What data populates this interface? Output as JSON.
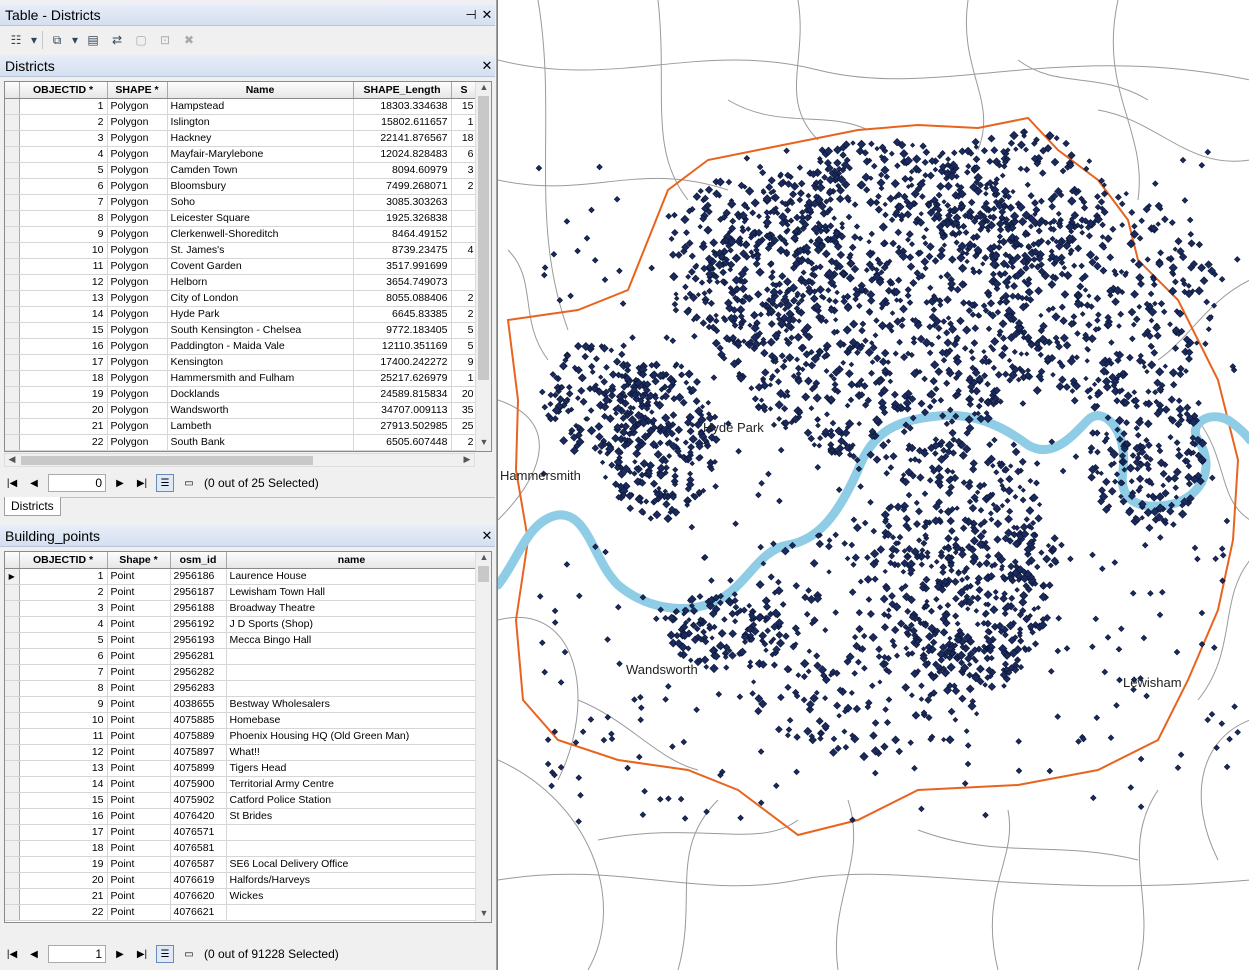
{
  "window": {
    "title": "Table - Districts",
    "pin": "⊣",
    "close": "✕"
  },
  "toolbar": {
    "icons": [
      "table-options-icon",
      "dropdown-icon",
      "related-tables-icon",
      "dropdown-icon",
      "select-by-attributes-icon",
      "switch-selection-icon",
      "clear-selection-icon",
      "zoom-to-selected-icon",
      "delete-selected-icon"
    ]
  },
  "districts": {
    "title": "Districts",
    "close": "✕",
    "columns": [
      "OBJECTID *",
      "SHAPE *",
      "Name",
      "SHAPE_Length",
      "S"
    ],
    "rows": [
      [
        "1",
        "Polygon",
        "Hampstead",
        "18303.334638",
        "15"
      ],
      [
        "2",
        "Polygon",
        "Islington",
        "15802.611657",
        "1"
      ],
      [
        "3",
        "Polygon",
        "Hackney",
        "22141.876567",
        "18"
      ],
      [
        "4",
        "Polygon",
        "Mayfair-Marylebone",
        "12024.828483",
        "6"
      ],
      [
        "5",
        "Polygon",
        "Camden Town",
        "8094.60979",
        "3"
      ],
      [
        "6",
        "Polygon",
        "Bloomsbury",
        "7499.268071",
        "2"
      ],
      [
        "7",
        "Polygon",
        "Soho",
        "3085.303263",
        ""
      ],
      [
        "8",
        "Polygon",
        "Leicester Square",
        "1925.326838",
        ""
      ],
      [
        "9",
        "Polygon",
        "Clerkenwell-Shoreditch",
        "8464.49152",
        ""
      ],
      [
        "10",
        "Polygon",
        "St. James's",
        "8739.23475",
        "4"
      ],
      [
        "11",
        "Polygon",
        "Covent Garden",
        "3517.991699",
        ""
      ],
      [
        "12",
        "Polygon",
        "Helborn",
        "3654.749073",
        ""
      ],
      [
        "13",
        "Polygon",
        "City of London",
        "8055.088406",
        "2"
      ],
      [
        "14",
        "Polygon",
        "Hyde Park",
        "6645.83385",
        "2"
      ],
      [
        "15",
        "Polygon",
        "South Kensington - Chelsea",
        "9772.183405",
        "5"
      ],
      [
        "16",
        "Polygon",
        "Paddington - Maida Vale",
        "12110.351169",
        "5"
      ],
      [
        "17",
        "Polygon",
        "Kensington",
        "17400.242272",
        "9"
      ],
      [
        "18",
        "Polygon",
        "Hammersmith and Fulham",
        "25217.626979",
        "1"
      ],
      [
        "19",
        "Polygon",
        "Docklands",
        "24589.815834",
        "20"
      ],
      [
        "20",
        "Polygon",
        "Wandsworth",
        "34707.009113",
        "35"
      ],
      [
        "21",
        "Polygon",
        "Lambeth",
        "27913.502985",
        "25"
      ],
      [
        "22",
        "Polygon",
        "South Bank",
        "6505.607448",
        "2"
      ]
    ],
    "record": "0",
    "selected": "(0 out of 25 Selected)",
    "tab": "Districts"
  },
  "buildings": {
    "title": "Building_points",
    "close": "✕",
    "columns": [
      "OBJECTID *",
      "Shape *",
      "osm_id",
      "name"
    ],
    "rows": [
      [
        "1",
        "Point",
        "2956186",
        "Laurence House"
      ],
      [
        "2",
        "Point",
        "2956187",
        "Lewisham Town Hall"
      ],
      [
        "3",
        "Point",
        "2956188",
        "Broadway Theatre"
      ],
      [
        "4",
        "Point",
        "2956192",
        "J D Sports (Shop)"
      ],
      [
        "5",
        "Point",
        "2956193",
        "Mecca Bingo Hall"
      ],
      [
        "6",
        "Point",
        "2956281",
        ""
      ],
      [
        "7",
        "Point",
        "2956282",
        ""
      ],
      [
        "8",
        "Point",
        "2956283",
        ""
      ],
      [
        "9",
        "Point",
        "4038655",
        "Bestway Wholesalers"
      ],
      [
        "10",
        "Point",
        "4075885",
        "Homebase"
      ],
      [
        "11",
        "Point",
        "4075889",
        "Phoenix Housing HQ (Old Green Man)"
      ],
      [
        "12",
        "Point",
        "4075897",
        "What!!"
      ],
      [
        "13",
        "Point",
        "4075899",
        "Tigers Head"
      ],
      [
        "14",
        "Point",
        "4075900",
        "Territorial Army Centre"
      ],
      [
        "15",
        "Point",
        "4075902",
        "Catford Police Station"
      ],
      [
        "16",
        "Point",
        "4076420",
        "St Brides"
      ],
      [
        "17",
        "Point",
        "4076571",
        ""
      ],
      [
        "18",
        "Point",
        "4076581",
        ""
      ],
      [
        "19",
        "Point",
        "4076587",
        "SE6 Local Delivery Office"
      ],
      [
        "20",
        "Point",
        "4076619",
        "Halfords/Harveys"
      ],
      [
        "21",
        "Point",
        "4076620",
        "Wickes"
      ],
      [
        "22",
        "Point",
        "4076621",
        ""
      ]
    ],
    "record": "1",
    "selected": "(0 out of 91228 Selected)"
  },
  "map": {
    "labels": [
      "Hyde Park",
      "Hammersmith",
      "Wandsworth",
      "Lewisham"
    ],
    "colors": {
      "points": "#1a2a5c",
      "boundary": "#e8641e",
      "river": "#a6dcef",
      "roads": "#9a9a9a"
    }
  }
}
